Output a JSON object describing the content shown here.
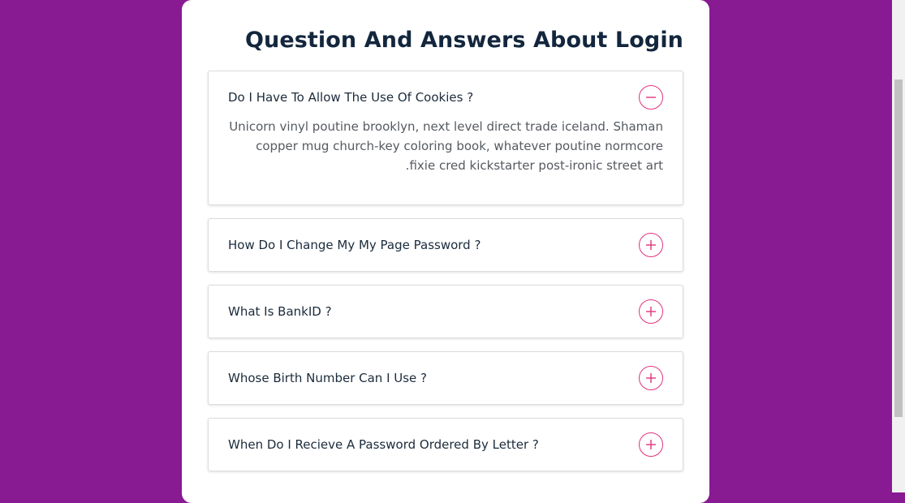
{
  "page": {
    "title": "Question And Answers About Login"
  },
  "colors": {
    "background": "#881a92",
    "accent": "#e0337e",
    "title": "#13263d"
  },
  "faq": [
    {
      "question": "Do I Have To Allow The Use Of Cookies ?",
      "answer": "Unicorn vinyl poutine brooklyn, next level direct trade iceland. Shaman copper mug church-key coloring book, whatever poutine normcore fixie cred kickstarter post-ironic street art.",
      "expanded": true,
      "icon": "minus-circle-icon"
    },
    {
      "question": "How Do I Change My My Page Password ?",
      "expanded": false,
      "icon": "plus-circle-icon"
    },
    {
      "question": "What Is BankID ?",
      "expanded": false,
      "icon": "plus-circle-icon"
    },
    {
      "question": "Whose Birth Number Can I Use ?",
      "expanded": false,
      "icon": "plus-circle-icon"
    },
    {
      "question": "When Do I Recieve A Password Ordered By Letter ?",
      "expanded": false,
      "icon": "plus-circle-icon"
    }
  ]
}
